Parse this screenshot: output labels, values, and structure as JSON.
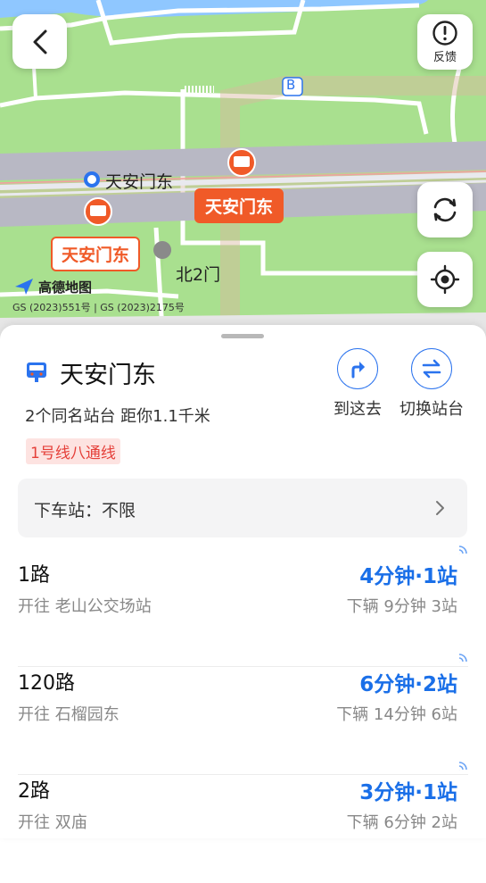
{
  "map": {
    "feedback_label": "反馈",
    "station_label_blue": "天安门东",
    "station_tag_left": "天安门东",
    "station_tag_right": "天安门东",
    "exit_label": "北2门",
    "exit_b_label": "B",
    "logo_text": "高德地图",
    "copyright": "GS (2023)551号 | GS (2023)2175号"
  },
  "sheet": {
    "station_name": "天安门东",
    "station_info": "2个同名站台  距你1.1千米",
    "line_badge": "1号线八通线",
    "goto_label": "到这去",
    "switch_label": "切换站台",
    "getoff_label": "下车站：不限"
  },
  "routes": [
    {
      "name": "1路",
      "dest": "开往 老山公交场站",
      "eta": "4分钟·1站",
      "sub": "下辆  9分钟 3站"
    },
    {
      "name": "120路",
      "dest": "开往 石榴园东",
      "eta": "6分钟·2站",
      "sub": "下辆  14分钟 6站"
    },
    {
      "name": "2路",
      "dest": "开往 双庙",
      "eta": "3分钟·1站",
      "sub": "下辆  6分钟 2站"
    }
  ],
  "colors": {
    "accent": "#1a6fe8",
    "station_red": "#f05a28",
    "map_green": "#a9e08f"
  }
}
